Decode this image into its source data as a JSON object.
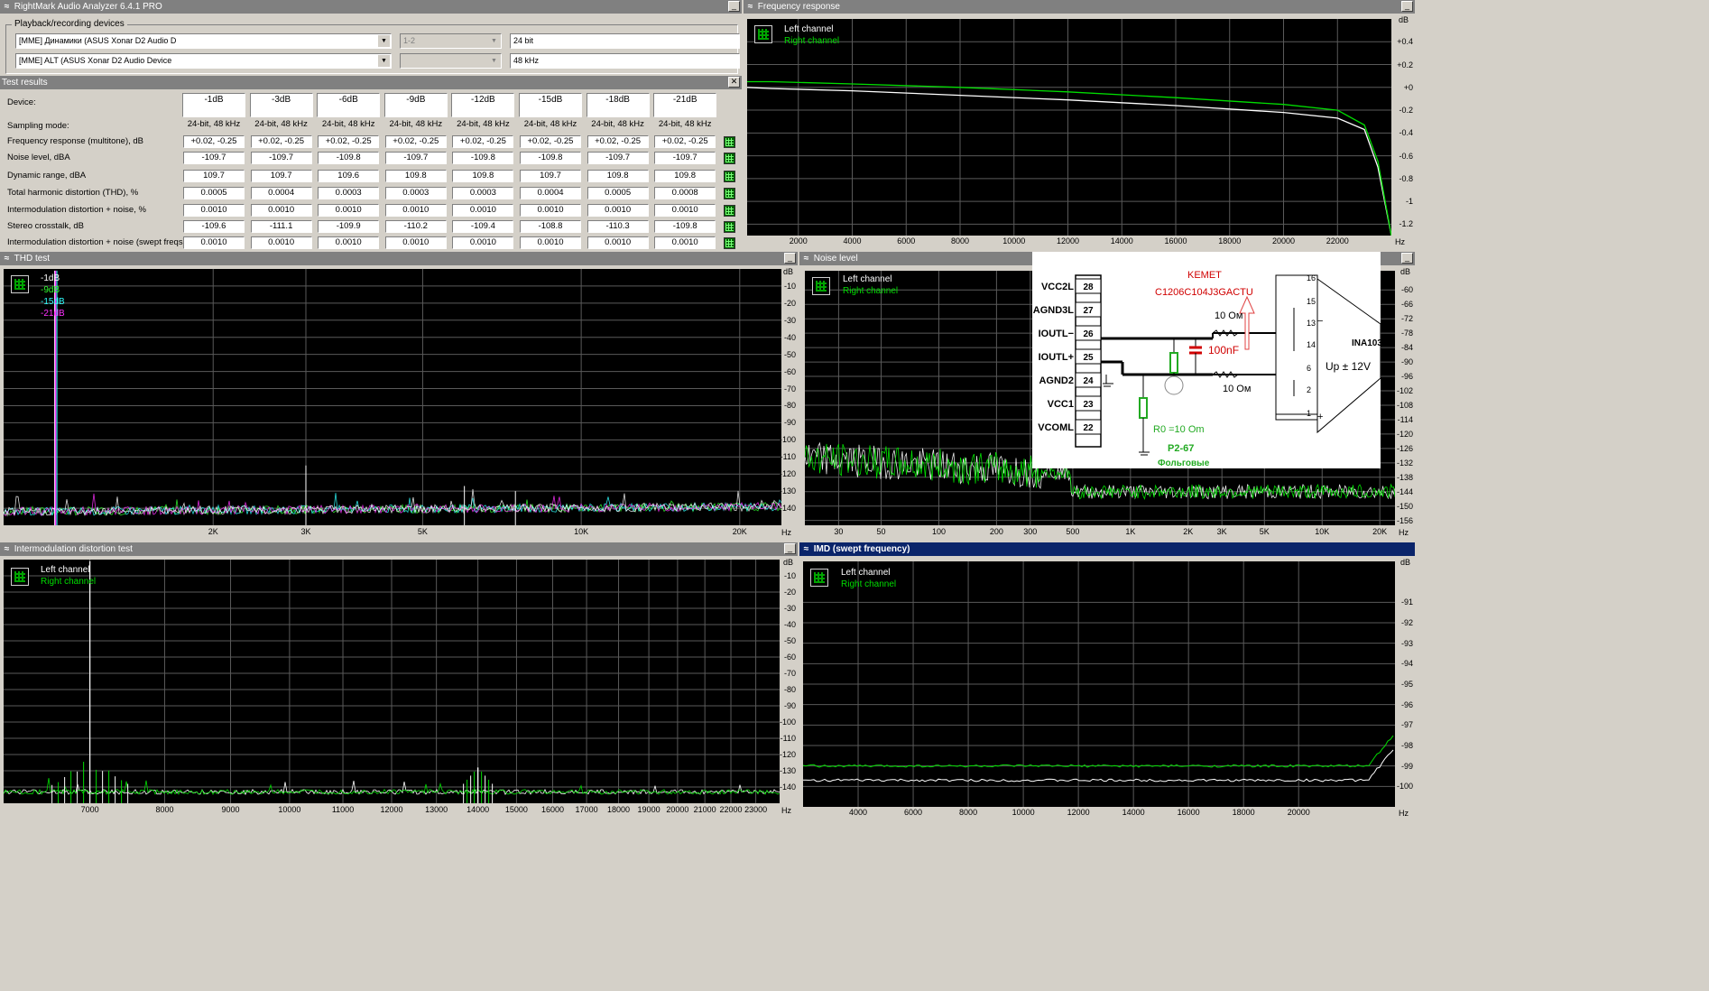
{
  "main_window": {
    "title": "RightMark Audio Analyzer 6.4.1 PRO",
    "devices_group_label": "Playback/recording devices",
    "playback_device": "[MME] Динамики (ASUS Xonar D2 Audio D",
    "recording_device": "[MME] ALT (ASUS Xonar D2 Audio Device",
    "channels": "1-2",
    "bit_depth": "24 bit",
    "sample_rate": "48 kHz"
  },
  "test_results": {
    "title": "Test results",
    "device_label": "Device:",
    "columns": [
      "-1dB",
      "-3dB",
      "-6dB",
      "-9dB",
      "-12dB",
      "-15dB",
      "-18dB",
      "-21dB"
    ],
    "sampling_label": "Sampling mode:",
    "sampling_mode": "24-bit, 48 kHz",
    "rows": [
      {
        "label": "Frequency response (multitone), dB",
        "values": [
          "+0.02, -0.25",
          "+0.02, -0.25",
          "+0.02, -0.25",
          "+0.02, -0.25",
          "+0.02, -0.25",
          "+0.02, -0.25",
          "+0.02, -0.25",
          "+0.02, -0.25"
        ]
      },
      {
        "label": "Noise level, dBA",
        "values": [
          "-109.7",
          "-109.7",
          "-109.8",
          "-109.7",
          "-109.8",
          "-109.8",
          "-109.7",
          "-109.7"
        ]
      },
      {
        "label": "Dynamic range, dBA",
        "values": [
          "109.7",
          "109.7",
          "109.6",
          "109.8",
          "109.8",
          "109.7",
          "109.8",
          "109.8"
        ]
      },
      {
        "label": "Total harmonic distortion (THD), %",
        "values": [
          "0.0005",
          "0.0004",
          "0.0003",
          "0.0003",
          "0.0003",
          "0.0004",
          "0.0005",
          "0.0008"
        ]
      },
      {
        "label": "Intermodulation distortion + noise, %",
        "values": [
          "0.0010",
          "0.0010",
          "0.0010",
          "0.0010",
          "0.0010",
          "0.0010",
          "0.0010",
          "0.0010"
        ]
      },
      {
        "label": "Stereo crosstalk, dB",
        "values": [
          "-109.6",
          "-111.1",
          "-109.9",
          "-110.2",
          "-109.4",
          "-108.8",
          "-110.3",
          "-109.8"
        ]
      },
      {
        "label": "Intermodulation distortion + noise (swept freqs), %",
        "values": [
          "0.0010",
          "0.0010",
          "0.0010",
          "0.0010",
          "0.0010",
          "0.0010",
          "0.0010",
          "0.0010"
        ]
      }
    ]
  },
  "colors": {
    "left": "#ffffff",
    "right": "#00dd00",
    "thd1": "#ffffff",
    "thd2": "#30ff30",
    "thd3": "#30ffff",
    "thd4": "#ff30ff",
    "grid": "#5a5a5a"
  },
  "icons": {
    "panel": "speaker-wave-icon",
    "close": "close-icon",
    "minimize": "minimize-icon",
    "graph": "grid-graph-icon",
    "dropdown": "chevron-down-icon"
  },
  "chart_data": [
    {
      "id": "freq",
      "type": "line",
      "title": "Frequency response",
      "legend": [
        "Left channel",
        "Right channel"
      ],
      "xlabel": "Hz",
      "ylabel": "dB",
      "xlim": [
        100,
        24000
      ],
      "ylim": [
        -1.3,
        0.6
      ],
      "xticks": [
        "2000",
        "4000",
        "6000",
        "8000",
        "10000",
        "12000",
        "14000",
        "16000",
        "18000",
        "20000",
        "22000"
      ],
      "yticks": [
        "+0.4",
        "+0.2",
        "+0",
        "-0.2",
        "-0.4",
        "-0.6",
        "-0.8",
        "-1",
        "-1.2"
      ],
      "series": [
        {
          "name": "Left channel",
          "x": [
            100,
            1000,
            4000,
            8000,
            12000,
            16000,
            20000,
            22000,
            23000,
            23500,
            24000
          ],
          "y": [
            0.0,
            -0.01,
            -0.03,
            -0.07,
            -0.11,
            -0.16,
            -0.22,
            -0.27,
            -0.37,
            -0.7,
            -1.3
          ]
        },
        {
          "name": "Right channel",
          "x": [
            100,
            1000,
            4000,
            8000,
            12000,
            16000,
            20000,
            22000,
            23000,
            23500,
            24000
          ],
          "y": [
            0.05,
            0.05,
            0.03,
            0.0,
            -0.04,
            -0.09,
            -0.15,
            -0.2,
            -0.33,
            -0.65,
            -1.3
          ]
        }
      ]
    },
    {
      "id": "thd",
      "type": "line",
      "title": "THD test",
      "legend": [
        "-1dB",
        "-9dB",
        "-15dB",
        "-21dB"
      ],
      "xlabel": "Hz",
      "ylabel": "dB",
      "ylim": [
        -150,
        0
      ],
      "xticks": [
        "2K",
        "3K",
        "5K",
        "10K",
        "20K"
      ],
      "yticks": [
        "-10",
        "-20",
        "-30",
        "-40",
        "-50",
        "-60",
        "-70",
        "-80",
        "-90",
        "-100",
        "-110",
        "-120",
        "-130",
        "-140"
      ],
      "peaks": [
        {
          "x": 1000,
          "y": -1
        },
        {
          "x": 3000,
          "y": -115
        },
        {
          "x": 6000,
          "y": -127
        },
        {
          "x": 7500,
          "y": -130
        }
      ],
      "noise_floor": -142
    },
    {
      "id": "noise",
      "type": "line",
      "title": "Noise level",
      "legend": [
        "Left channel",
        "Right channel"
      ],
      "xlabel": "Hz",
      "ylabel": "dB",
      "ylim": [
        -158,
        -52
      ],
      "xticks": [
        "30",
        "50",
        "100",
        "200",
        "300",
        "500",
        "1K",
        "2K",
        "3K",
        "5K",
        "10K",
        "20K"
      ],
      "yticks": [
        "-60",
        "-66",
        "-72",
        "-78",
        "-84",
        "-90",
        "-96",
        "-102",
        "-108",
        "-114",
        "-120",
        "-126",
        "-132",
        "-138",
        "-144",
        "-150",
        "-156"
      ],
      "noise_floor": -145
    },
    {
      "id": "imd",
      "type": "line",
      "title": "Intermodulation distortion test",
      "legend": [
        "Left channel",
        "Right channel"
      ],
      "xlabel": "Hz",
      "ylabel": "dB",
      "ylim": [
        -150,
        0
      ],
      "xticks": [
        "7000",
        "8000",
        "9000",
        "10000",
        "11000",
        "12000",
        "13000",
        "14000",
        "15000",
        "16000",
        "17000",
        "18000",
        "19000",
        "20000",
        "21000",
        "22000",
        "23000"
      ],
      "yticks": [
        "-10",
        "-20",
        "-30",
        "-40",
        "-50",
        "-60",
        "-70",
        "-80",
        "-90",
        "-100",
        "-110",
        "-120",
        "-130",
        "-140"
      ],
      "peaks": [
        {
          "x": 7000,
          "y": -1
        },
        {
          "x": 14000,
          "y": -128
        }
      ],
      "noise_floor": -143
    },
    {
      "id": "imdsw",
      "type": "line",
      "title": "IMD (swept frequency)",
      "legend": [
        "Left channel",
        "Right channel"
      ],
      "xlabel": "Hz",
      "ylabel": "dB",
      "ylim": [
        -101,
        -89
      ],
      "xticks": [
        "4000",
        "6000",
        "8000",
        "10000",
        "12000",
        "14000",
        "16000",
        "18000",
        "20000"
      ],
      "yticks": [
        "-91",
        "-92",
        "-93",
        "-94",
        "-95",
        "-96",
        "-97",
        "-98",
        "-99",
        "-100"
      ],
      "series": [
        {
          "name": "Left channel",
          "level": -99.7
        },
        {
          "name": "Right channel",
          "level": -99.0
        }
      ]
    }
  ],
  "schematic": {
    "pins": [
      {
        "name": "VCC2L",
        "num": "28"
      },
      {
        "name": "AGND3L",
        "num": "27"
      },
      {
        "name": "IOUTL−",
        "num": "26"
      },
      {
        "name": "IOUTL+",
        "num": "25"
      },
      {
        "name": "AGND2",
        "num": "24"
      },
      {
        "name": "VCC1",
        "num": "23"
      },
      {
        "name": "VCOML",
        "num": "22"
      }
    ],
    "kemet": "KEMET",
    "cap_part": "C1206C104J3GACTU",
    "cap": "100nF",
    "r_top": "10 Ом",
    "r_bot": "10 Ом",
    "r0": "R0 =10 Om",
    "r_type": "P2-67",
    "r_type2": "Фольговые",
    "amp": "INA103",
    "supply": "Up ± 12V",
    "amp_pins": [
      "16",
      "15",
      "13",
      "14",
      "6",
      "2",
      "1"
    ],
    "amp_minus": "−",
    "amp_plus": "+"
  }
}
